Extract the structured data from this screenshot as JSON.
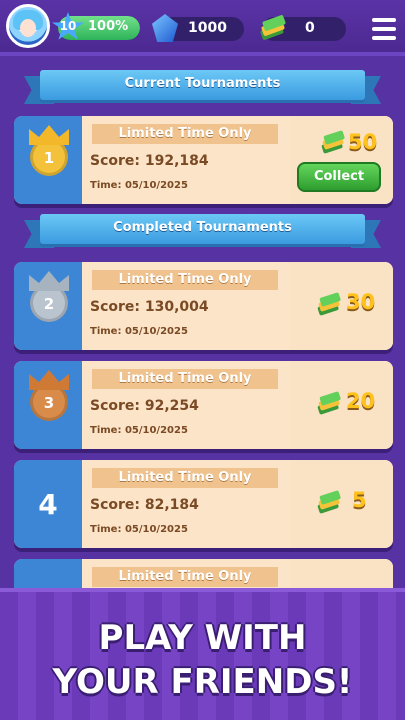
{
  "header": {
    "level": "10",
    "level_progress": 1.0,
    "level_percent": "100%",
    "gems": "1000",
    "cash": "0"
  },
  "sections": {
    "current": "Current Tournaments",
    "completed": "Completed Tournaments"
  },
  "current_tournament": {
    "rank": "1",
    "title": "Limited Time Only",
    "score_label": "Score:",
    "score": "192,184",
    "time_label": "Time:",
    "time": "05/10/2025",
    "reward": "50",
    "collect_label": "Collect"
  },
  "completed_tournaments": [
    {
      "rank": "2",
      "title": "Limited Time Only",
      "score_label": "Score:",
      "score": "130,004",
      "time_label": "Time:",
      "time": "05/10/2025",
      "reward": "30"
    },
    {
      "rank": "3",
      "title": "Limited Time Only",
      "score_label": "Score:",
      "score": "92,254",
      "time_label": "Time:",
      "time": "05/10/2025",
      "reward": "20"
    },
    {
      "rank": "4",
      "title": "Limited Time Only",
      "score_label": "Score:",
      "score": "82,184",
      "time_label": "Time:",
      "time": "05/10/2025",
      "reward": "5"
    },
    {
      "title": "Limited Time Only"
    }
  ],
  "promo": {
    "line1": "PLAY WITH",
    "line2": "YOUR FRIENDS!"
  },
  "colors": {
    "gold": "#f3c13a",
    "silver": "#b9c4cf",
    "bronze": "#d98b4a",
    "rank_blue": "#3d86d6"
  }
}
